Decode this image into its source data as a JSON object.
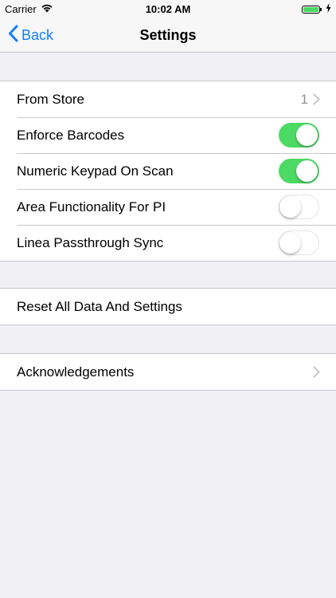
{
  "status_bar": {
    "carrier": "Carrier",
    "time": "10:02 AM",
    "battery_level": 1.0,
    "icons": [
      "wifi-icon",
      "battery-icon",
      "charging-bolt-icon"
    ]
  },
  "nav": {
    "back_label": "Back",
    "title": "Settings"
  },
  "settings_group": [
    {
      "label": "From Store",
      "value": "1",
      "kind": "disclosure"
    },
    {
      "label": "Enforce Barcodes",
      "kind": "toggle",
      "on": true
    },
    {
      "label": "Numeric Keypad On Scan",
      "kind": "toggle",
      "on": true
    },
    {
      "label": "Area Functionality For PI",
      "kind": "toggle",
      "on": false
    },
    {
      "label": "Linea Passthrough Sync",
      "kind": "toggle",
      "on": false
    }
  ],
  "reset_group": {
    "label": "Reset All Data And Settings"
  },
  "about_group": {
    "label": "Acknowledgements"
  },
  "colors": {
    "accent": "#157efb",
    "toggle_on": "#4cd964",
    "background": "#efeff4",
    "separator": "#c8c7cc",
    "secondary_text": "#8e8e93"
  }
}
